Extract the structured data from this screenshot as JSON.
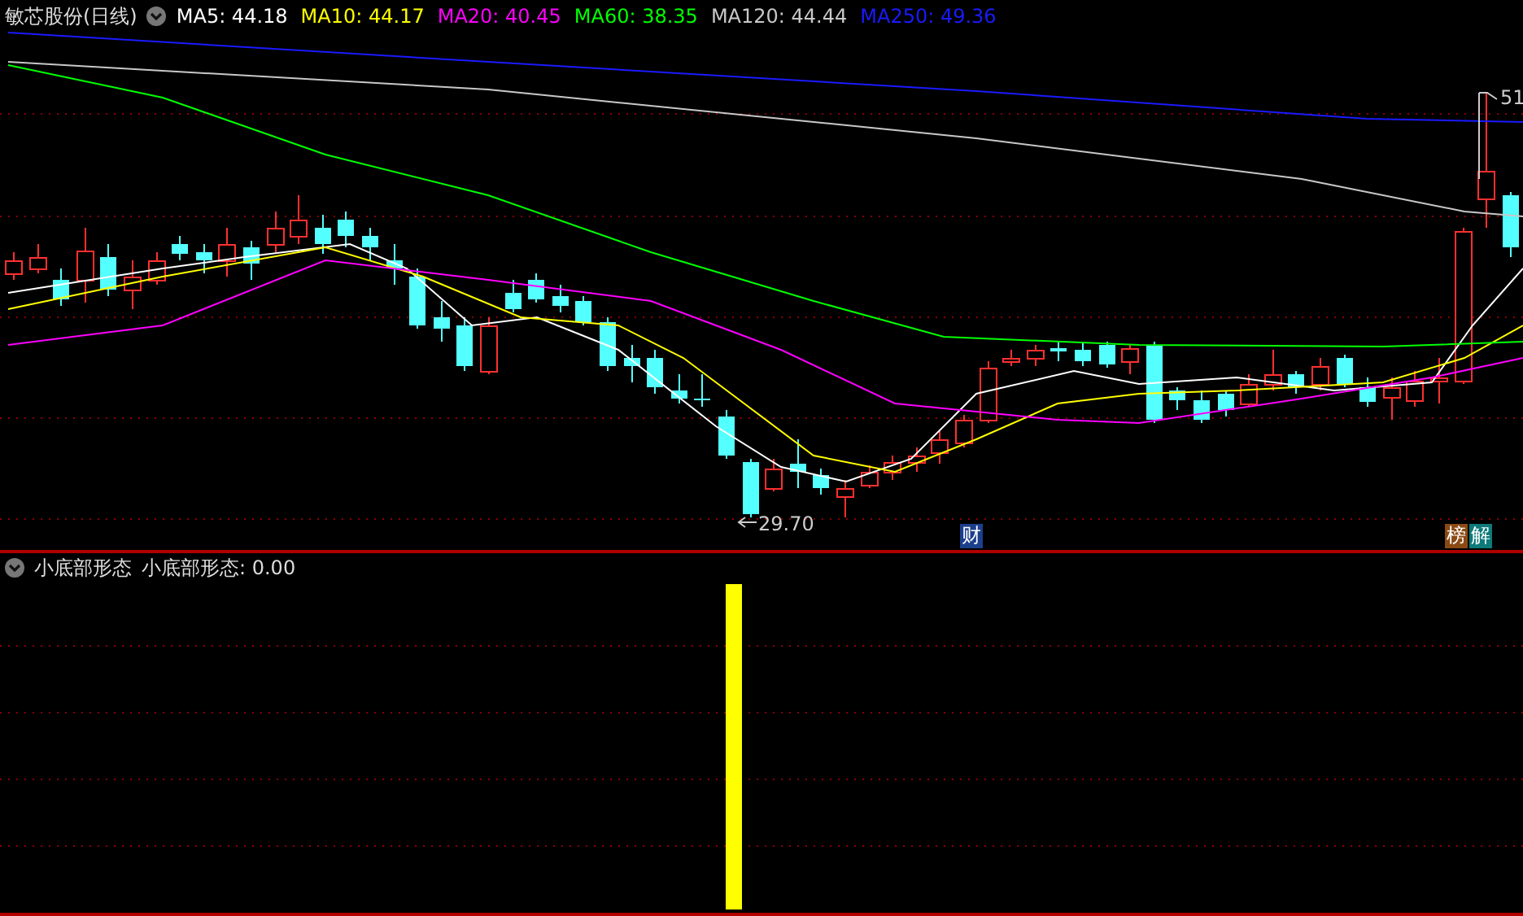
{
  "chart": {
    "title": "敏芯股份(日线)",
    "moving_averages": [
      {
        "label": "MA5: 44.18",
        "color": "#ffffff"
      },
      {
        "label": "MA10: 44.17",
        "color": "#ffff00"
      },
      {
        "label": "MA20: 40.45",
        "color": "#ff00ff"
      },
      {
        "label": "MA60: 38.35",
        "color": "#00ff00"
      },
      {
        "label": "MA120: 44.44",
        "color": "#c8c8c8"
      },
      {
        "label": "MA250: 49.36",
        "color": "#1a1aff"
      }
    ],
    "low_label": "29.70",
    "high_label": "51",
    "events": [
      {
        "label": "财",
        "color": "#1c3f8c"
      },
      {
        "label": "榜",
        "color": "#8b4a14"
      },
      {
        "label": "解",
        "color": "#0e7a7a"
      }
    ]
  },
  "indicator": {
    "name": "小底部形态",
    "reading": "小底部形态: 0.00"
  }
}
